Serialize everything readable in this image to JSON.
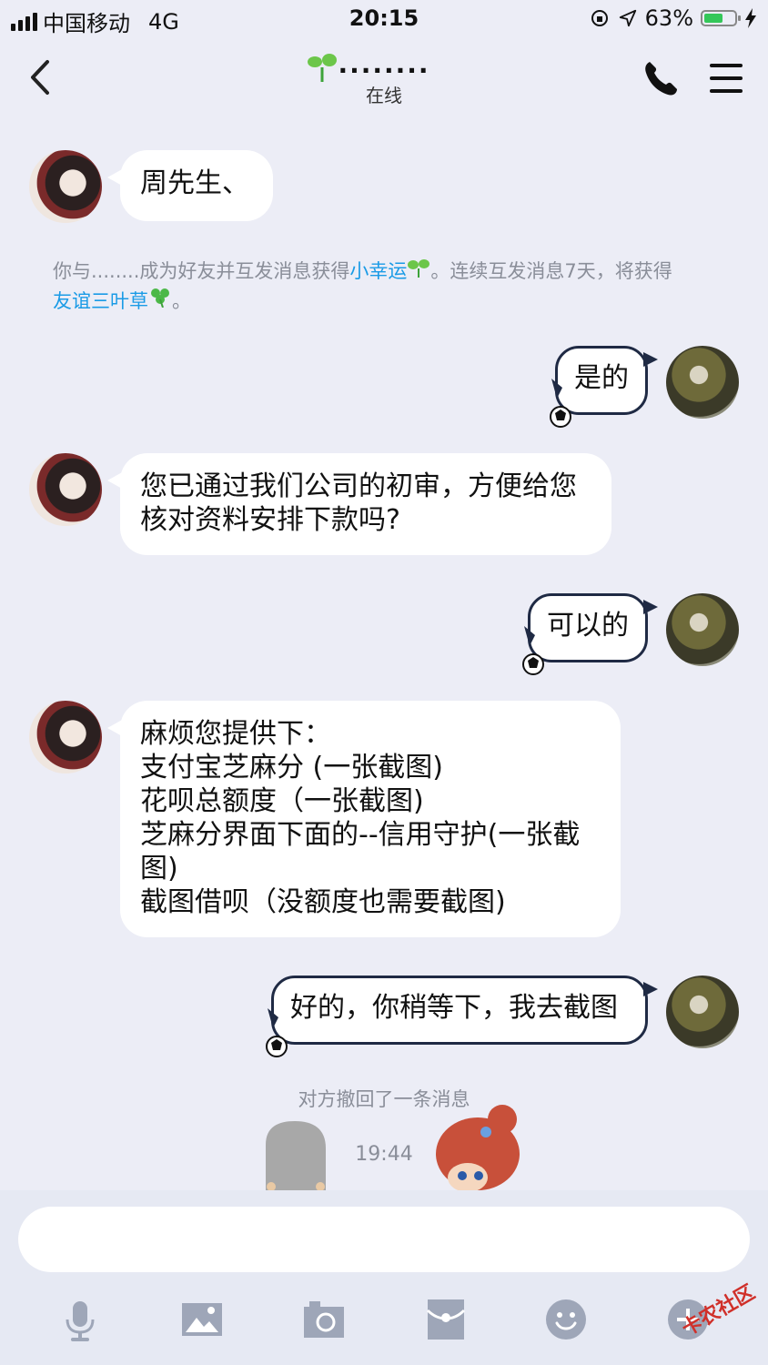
{
  "status_bar": {
    "carrier": "中国移动",
    "network": "4G",
    "time": "20:15",
    "battery": "63%",
    "battery_level": 0.63
  },
  "nav": {
    "title": "........",
    "subtitle": "在线",
    "icons": [
      "chevron-left-icon",
      "sprout-icon",
      "phone-icon",
      "menu-icon"
    ]
  },
  "messages": [
    {
      "side": "in",
      "text": "周先生、"
    },
    {
      "side": "out",
      "text": "是的"
    },
    {
      "side": "in",
      "text": "您已通过我们公司的初审，方便给您核对资料安排下款吗?"
    },
    {
      "side": "out",
      "text": "可以的"
    },
    {
      "side": "in",
      "lines": [
        "麻烦您提供下：",
        "支付宝芝麻分 (一张截图)",
        "花呗总额度（一张截图)",
        "芝麻分界面下面的--信用守护(一张截",
        "图)",
        "截图借呗（没额度也需要截图)"
      ]
    },
    {
      "side": "out",
      "text": "好的，你稍等下，我去截图"
    }
  ],
  "system_note": {
    "prefix": "你与........成为好友并互发消息获得",
    "link1": "小幸运",
    "middle": "。连续互发消息7天，将获得",
    "link2": "友谊三叶草",
    "suffix": "。"
  },
  "recall_notice": "对方撤回了一条消息",
  "timestamp": "19:44",
  "input": {
    "placeholder": ""
  },
  "toolbar": [
    "microphone-icon",
    "image-icon",
    "camera-icon",
    "red-packet-icon",
    "emoji-icon",
    "plus-icon"
  ],
  "watermark": "卡农社区",
  "colors": {
    "link": "#1a9be6",
    "bubble_border": "#1f2a44",
    "background": "#ecedf6",
    "toolbar_icon": "#9ea6b8"
  }
}
